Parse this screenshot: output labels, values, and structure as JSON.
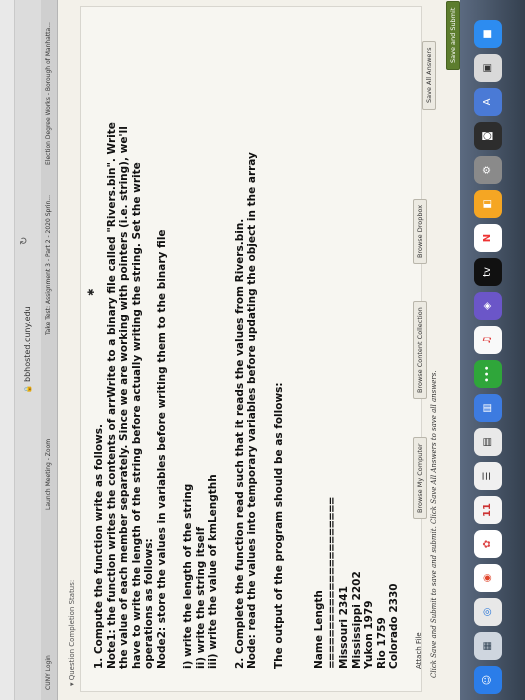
{
  "browser": {
    "url": "bbhosted.cuny.edu",
    "tabs": [
      "CUNY Login",
      "Launch Meeting - Zoom",
      "Take Test: Assignment 3 - Part 2 - 2020 Sprin...",
      "Election Degree Works - Borough of Manhatta..."
    ]
  },
  "page": {
    "status_heading": "▾ Question Completion Status:",
    "paragraphs": [
      "1. Compute the function write as follows.",
      "Note1: the function writes the contents of arrWrite to a binary file called \"Rivers.bin\". Write",
      "the value of each member separately. Since we are working with pointers (i.e. string), we'll",
      "have to write the length of the string before actually writing the string. Set the write",
      "operations as follows:",
      "Node2: store the values in variables before writing them to the binary file"
    ],
    "write_steps": [
      "i) write the length of the string",
      "ii) write the string itself",
      "iii) write the value of kmLengthh"
    ],
    "part2": [
      "2. Complete the function read such that it reads the values from Rivers.bin.",
      "Node: read the values into temporary variables before updating the object in the array"
    ],
    "output_intro": "The output of the program should be as follows:",
    "table_header": "Name Length",
    "table_rule": "======================",
    "rivers": [
      "Missouri 2341",
      "Mississippi 2202",
      "Yukon 1979",
      "Rio 1759",
      "Colorado 2330"
    ],
    "attach_label": "Attach File",
    "browse_buttons": [
      "Browse My Computer",
      "Browse Content Collection",
      "Browse Dropbox"
    ],
    "submit_instructions": "Click Save and Submit to save and submit. Click Save All Answers to save all answers.",
    "save_all_label": "Save All Answers",
    "save_submit_label": "Save and Submit"
  },
  "dock": {
    "appletv_label": "tv",
    "calendar_day": "11"
  },
  "colors": {
    "page_bg": "#f3f1ea",
    "submit_green": "#5d7d2e",
    "dock_bg": "#46536a"
  }
}
